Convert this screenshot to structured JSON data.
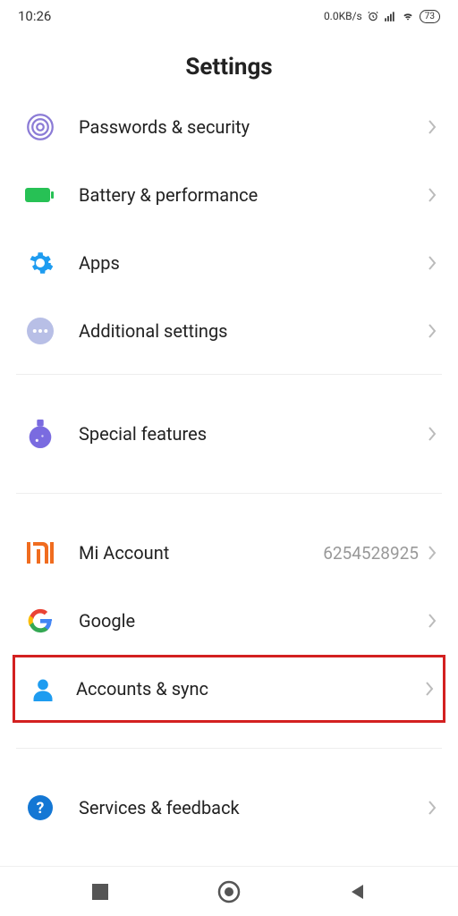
{
  "status": {
    "time": "10:26",
    "data_rate": "0.0KB/s",
    "battery": "73"
  },
  "page_title": "Settings",
  "items": [
    {
      "id": "passwords",
      "label": "Passwords & security",
      "icon": "touch"
    },
    {
      "id": "battery",
      "label": "Battery & performance",
      "icon": "battery"
    },
    {
      "id": "apps",
      "label": "Apps",
      "icon": "gear"
    },
    {
      "id": "additional",
      "label": "Additional settings",
      "icon": "dots"
    },
    {
      "id": "special",
      "label": "Special features",
      "icon": "potion"
    },
    {
      "id": "mi",
      "label": "Mi Account",
      "icon": "mi",
      "value": "6254528925"
    },
    {
      "id": "google",
      "label": "Google",
      "icon": "google"
    },
    {
      "id": "accounts",
      "label": "Accounts & sync",
      "icon": "person",
      "highlighted": true
    },
    {
      "id": "services",
      "label": "Services & feedback",
      "icon": "help"
    }
  ]
}
